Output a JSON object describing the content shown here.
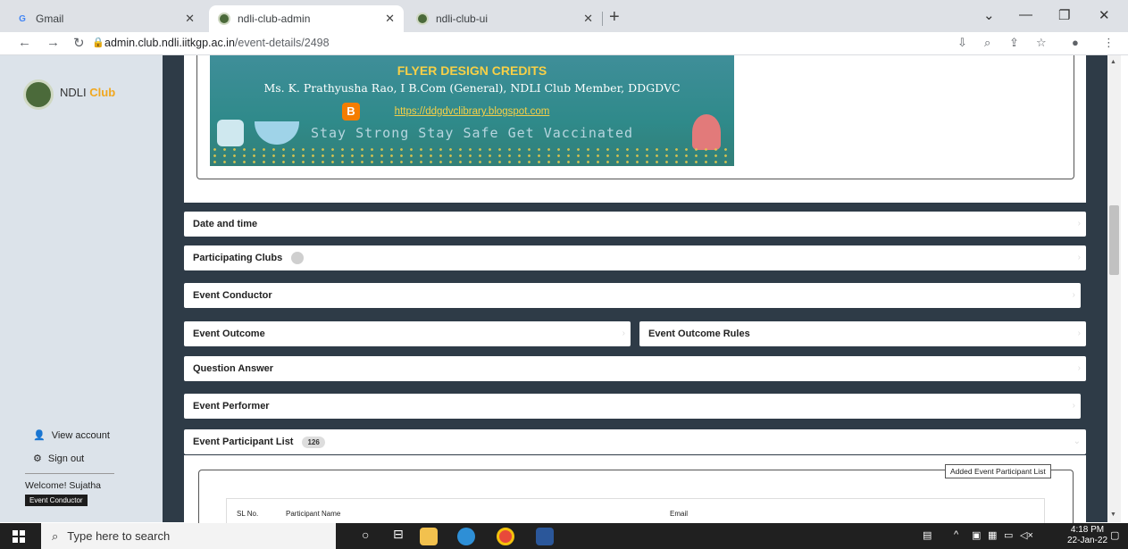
{
  "browser": {
    "tabs": [
      {
        "title": "Gmail",
        "icon": "gmail-icon"
      },
      {
        "title": "ndli-club-admin",
        "icon": "ndli-icon",
        "active": true
      },
      {
        "title": "ndli-club-ui",
        "icon": "ndli-icon"
      }
    ],
    "url_host": "admin.club.ndli.iitkgp.ac.in",
    "url_path": "/event-details/2498"
  },
  "sidebar": {
    "logo_name": "NDLI",
    "logo_club": "Club",
    "view_account": "View account",
    "sign_out": "Sign out",
    "welcome": "Welcome! Sujatha",
    "role": "Event Conductor"
  },
  "flyer": {
    "title": "FLYER DESIGN CREDITS",
    "credit": "Ms. K. Prathyusha Rao, I B.Com (General), NDLI Club Member, DDGDVC",
    "link": "https://ddgdvclibrary.blogspot.com",
    "slogan": "Stay Strong Stay Safe Get Vaccinated"
  },
  "sections": {
    "date_time": "Date and time",
    "participating_clubs": "Participating Clubs",
    "event_conductor": "Event Conductor",
    "event_outcome": "Event Outcome",
    "event_outcome_rules": "Event Outcome Rules",
    "question_answer": "Question Answer",
    "event_performer": "Event Performer",
    "event_participant_list": "Event Participant List",
    "participant_count": "126"
  },
  "participant_panel": {
    "legend": "Added Event Participant List",
    "columns": [
      "SL No.",
      "Participant Name",
      "Email"
    ]
  },
  "taskbar": {
    "search_placeholder": "Type here to search",
    "time": "4:18 PM",
    "date": "22-Jan-22"
  }
}
